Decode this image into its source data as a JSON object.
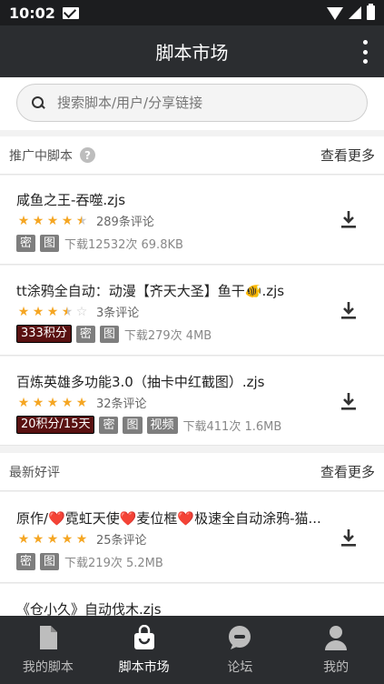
{
  "status": {
    "time": "10:02"
  },
  "app_bar": {
    "title": "脚本市场"
  },
  "search": {
    "placeholder": "搜索脚本/用户/分享链接"
  },
  "promoted": {
    "title": "推广中脚本",
    "more": "查看更多",
    "items": [
      {
        "title": "咸鱼之王-吞噬.zjs",
        "rating": 4.5,
        "reviews": "289条评论",
        "tags": [
          "密",
          "图"
        ],
        "stats": "下载12532次 69.8KB"
      },
      {
        "title": "tt涂鸦全自动：动漫【齐天大圣】鱼干🐠.zjs",
        "rating": 3.5,
        "reviews": "3条评论",
        "points": "333积分",
        "tags": [
          "密",
          "图"
        ],
        "stats": "下载279次 4MB"
      },
      {
        "title": "百炼英雄多功能3.0（抽卡中红截图）.zjs",
        "rating": 5,
        "reviews": "32条评论",
        "points": "20积分/15天",
        "tags": [
          "密",
          "图",
          "视频"
        ],
        "stats": "下载411次 1.6MB"
      }
    ]
  },
  "latest": {
    "title": "最新好评",
    "more": "查看更多",
    "items": [
      {
        "title": "原作/❤️霓虹天使❤️麦位框❤️极速全自动涂鸦-猫...",
        "rating": 5,
        "reviews": "25条评论",
        "tags": [
          "密",
          "图"
        ],
        "stats": "下载219次 5.2MB"
      },
      {
        "title": "《仓小久》自动伐木.zjs"
      }
    ]
  },
  "nav": [
    {
      "label": "我的脚本",
      "icon": "file-icon"
    },
    {
      "label": "脚本市场",
      "icon": "shopping-bag-icon"
    },
    {
      "label": "论坛",
      "icon": "chat-icon"
    },
    {
      "label": "我的",
      "icon": "person-icon"
    }
  ],
  "colors": {
    "accent_star": "#f5a623",
    "points_tag": "#5a1111",
    "bar": "#2b2d30"
  }
}
